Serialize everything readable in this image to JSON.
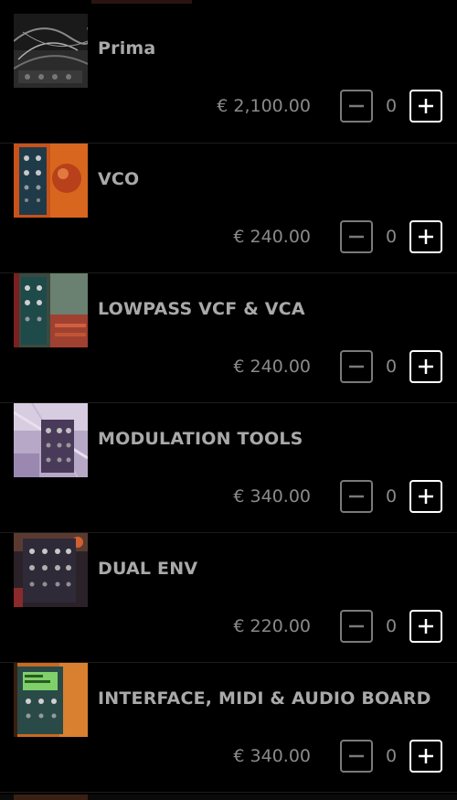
{
  "currency_symbol": "€",
  "colors": {
    "background": "#000000",
    "name_text": "#a9a9a9",
    "price_text": "#8a8a8a",
    "minus_border": "#7a7a7a",
    "plus_border": "#ffffff"
  },
  "products": [
    {
      "name": "Prima",
      "price": "€ 2,100.00",
      "quantity": "0",
      "thumbnail": "modular-cables-photo"
    },
    {
      "name": "VCO",
      "price": "€ 240.00",
      "quantity": "0",
      "thumbnail": "vco-module-photo"
    },
    {
      "name": "LOWPASS VCF & VCA",
      "price": "€ 240.00",
      "quantity": "0",
      "thumbnail": "vcf-vca-module-photo"
    },
    {
      "name": "MODULATION TOOLS",
      "price": "€ 340.00",
      "quantity": "0",
      "thumbnail": "modulation-tools-photo"
    },
    {
      "name": "DUAL ENV",
      "price": "€ 220.00",
      "quantity": "0",
      "thumbnail": "dual-env-module-photo"
    },
    {
      "name": "INTERFACE, MIDI & AUDIO BOARD",
      "price": "€ 340.00",
      "quantity": "0",
      "thumbnail": "interface-board-photo"
    }
  ],
  "icons": {
    "decrement": "minus-icon",
    "increment": "plus-icon"
  }
}
